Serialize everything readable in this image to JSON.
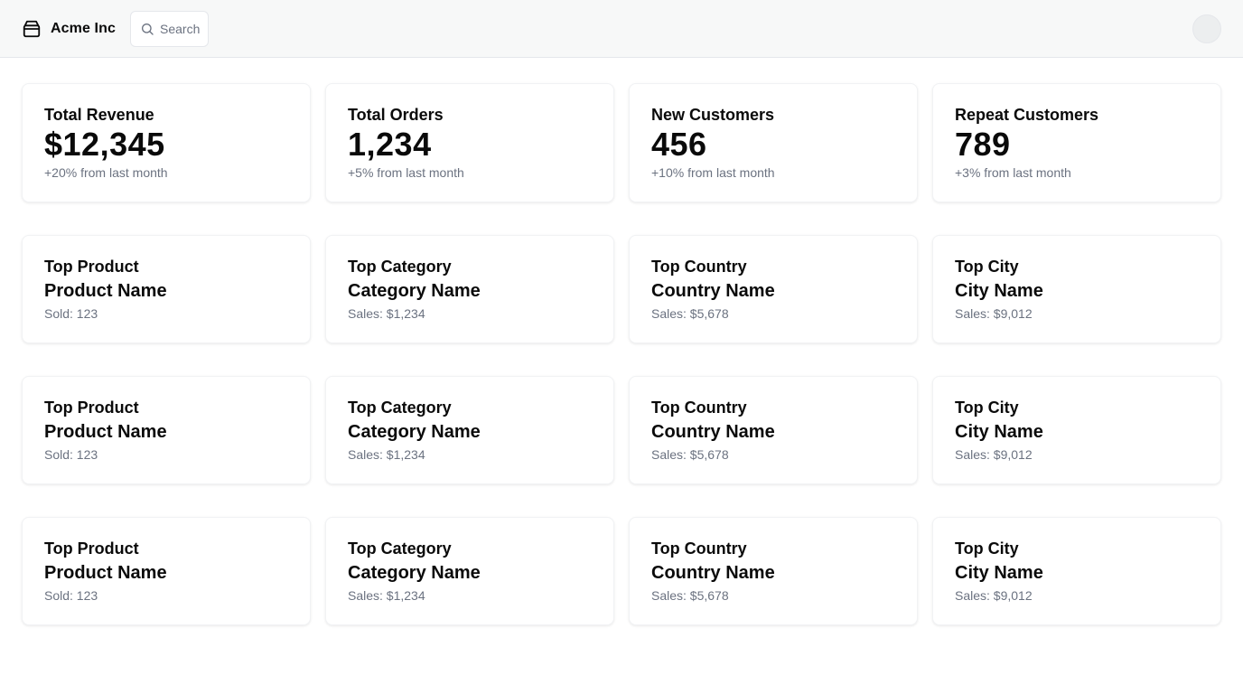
{
  "header": {
    "brand_name": "Acme Inc",
    "search_placeholder": "Search"
  },
  "stats": [
    {
      "label": "Total Revenue",
      "value": "$12,345",
      "change": "+20% from last month"
    },
    {
      "label": "Total Orders",
      "value": "1,234",
      "change": "+5% from last month"
    },
    {
      "label": "New Customers",
      "value": "456",
      "change": "+10% from last month"
    },
    {
      "label": "Repeat Customers",
      "value": "789",
      "change": "+3% from last month"
    }
  ],
  "top_rows": [
    [
      {
        "label": "Top Product",
        "name": "Product Name",
        "detail": "Sold: 123"
      },
      {
        "label": "Top Category",
        "name": "Category Name",
        "detail": "Sales: $1,234"
      },
      {
        "label": "Top Country",
        "name": "Country Name",
        "detail": "Sales: $5,678"
      },
      {
        "label": "Top City",
        "name": "City Name",
        "detail": "Sales: $9,012"
      }
    ],
    [
      {
        "label": "Top Product",
        "name": "Product Name",
        "detail": "Sold: 123"
      },
      {
        "label": "Top Category",
        "name": "Category Name",
        "detail": "Sales: $1,234"
      },
      {
        "label": "Top Country",
        "name": "Country Name",
        "detail": "Sales: $5,678"
      },
      {
        "label": "Top City",
        "name": "City Name",
        "detail": "Sales: $9,012"
      }
    ],
    [
      {
        "label": "Top Product",
        "name": "Product Name",
        "detail": "Sold: 123"
      },
      {
        "label": "Top Category",
        "name": "Category Name",
        "detail": "Sales: $1,234"
      },
      {
        "label": "Top Country",
        "name": "Country Name",
        "detail": "Sales: $5,678"
      },
      {
        "label": "Top City",
        "name": "City Name",
        "detail": "Sales: $9,012"
      }
    ]
  ]
}
